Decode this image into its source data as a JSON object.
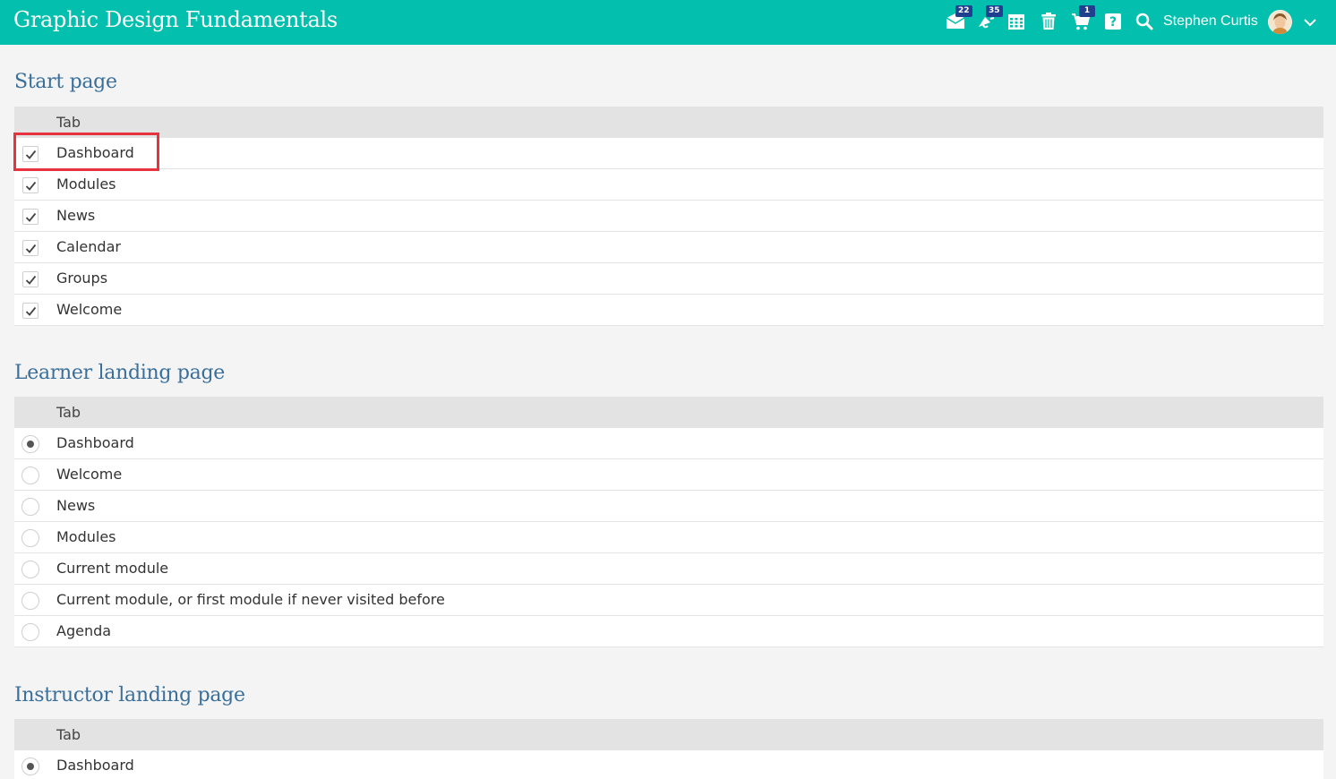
{
  "app": {
    "title": "Graphic Design Fundamentals"
  },
  "header": {
    "messages_badge": "22",
    "notifications_badge": "35",
    "cart_badge": "1",
    "user_name": "Stephen Curtis"
  },
  "start_page": {
    "title": "Start page",
    "column": "Tab",
    "rows": [
      {
        "label": "Dashboard",
        "checked": true
      },
      {
        "label": "Modules",
        "checked": true
      },
      {
        "label": "News",
        "checked": true
      },
      {
        "label": "Calendar",
        "checked": true
      },
      {
        "label": "Groups",
        "checked": true
      },
      {
        "label": "Welcome",
        "checked": true
      }
    ]
  },
  "learner_landing": {
    "title": "Learner landing page",
    "column": "Tab",
    "selected": "Dashboard",
    "rows": [
      {
        "label": "Dashboard"
      },
      {
        "label": "Welcome"
      },
      {
        "label": "News"
      },
      {
        "label": "Modules"
      },
      {
        "label": "Current module"
      },
      {
        "label": "Current module, or first module if never visited before"
      },
      {
        "label": "Agenda"
      }
    ]
  },
  "instructor_landing": {
    "title": "Instructor landing page",
    "column": "Tab",
    "selected": "Dashboard",
    "rows": [
      {
        "label": "Dashboard"
      }
    ]
  },
  "colors": {
    "header": "#03bfad",
    "section_title": "#3a6f9a",
    "badge": "#213f8f",
    "highlight": "#e7333d"
  }
}
